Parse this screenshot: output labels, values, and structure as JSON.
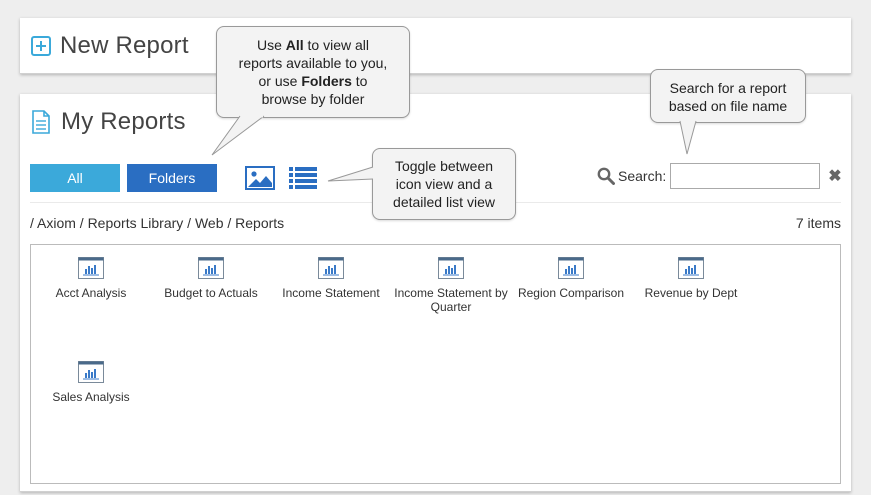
{
  "new_report": {
    "title": "New Report",
    "icon": "plus-square-icon"
  },
  "my_reports": {
    "title": "My Reports",
    "icon": "document-icon",
    "tabs": {
      "all_label": "All",
      "folders_label": "Folders"
    },
    "view_toggle": {
      "icon_view_icon": "image-icon",
      "list_view_icon": "list-icon"
    },
    "search": {
      "label": "Search:",
      "value": "",
      "placeholder": "",
      "clear_icon": "close-icon"
    },
    "breadcrumb": "/ Axiom / Reports Library / Web / Reports",
    "item_count": "7 items",
    "reports": [
      {
        "name": "Acct Analysis"
      },
      {
        "name": "Budget to Actuals"
      },
      {
        "name": "Income Statement"
      },
      {
        "name": "Income Statement by Quarter"
      },
      {
        "name": "Region Comparison"
      },
      {
        "name": "Revenue by Dept"
      },
      {
        "name": "Sales Analysis"
      }
    ]
  },
  "callouts": {
    "all_folders": {
      "line1_pre": "Use ",
      "line1_bold": "All",
      "line1_post": " to view all",
      "line2": "reports available to you,",
      "line3_pre": "or use ",
      "line3_bold": "Folders",
      "line3_post": " to",
      "line4": "browse by folder"
    },
    "search": {
      "line1": "Search for a report",
      "line2": "based on file name"
    },
    "toggle": {
      "line1": "Toggle between",
      "line2": "icon view and a",
      "line3": "detailed list view"
    }
  },
  "colors": {
    "all_button": "#3ba9da",
    "folders_button": "#2a6ec2",
    "title_icon": "#3ba9da",
    "report_icon_header": "#4a6a8a",
    "report_icon_bars": "#3a7ac8"
  }
}
